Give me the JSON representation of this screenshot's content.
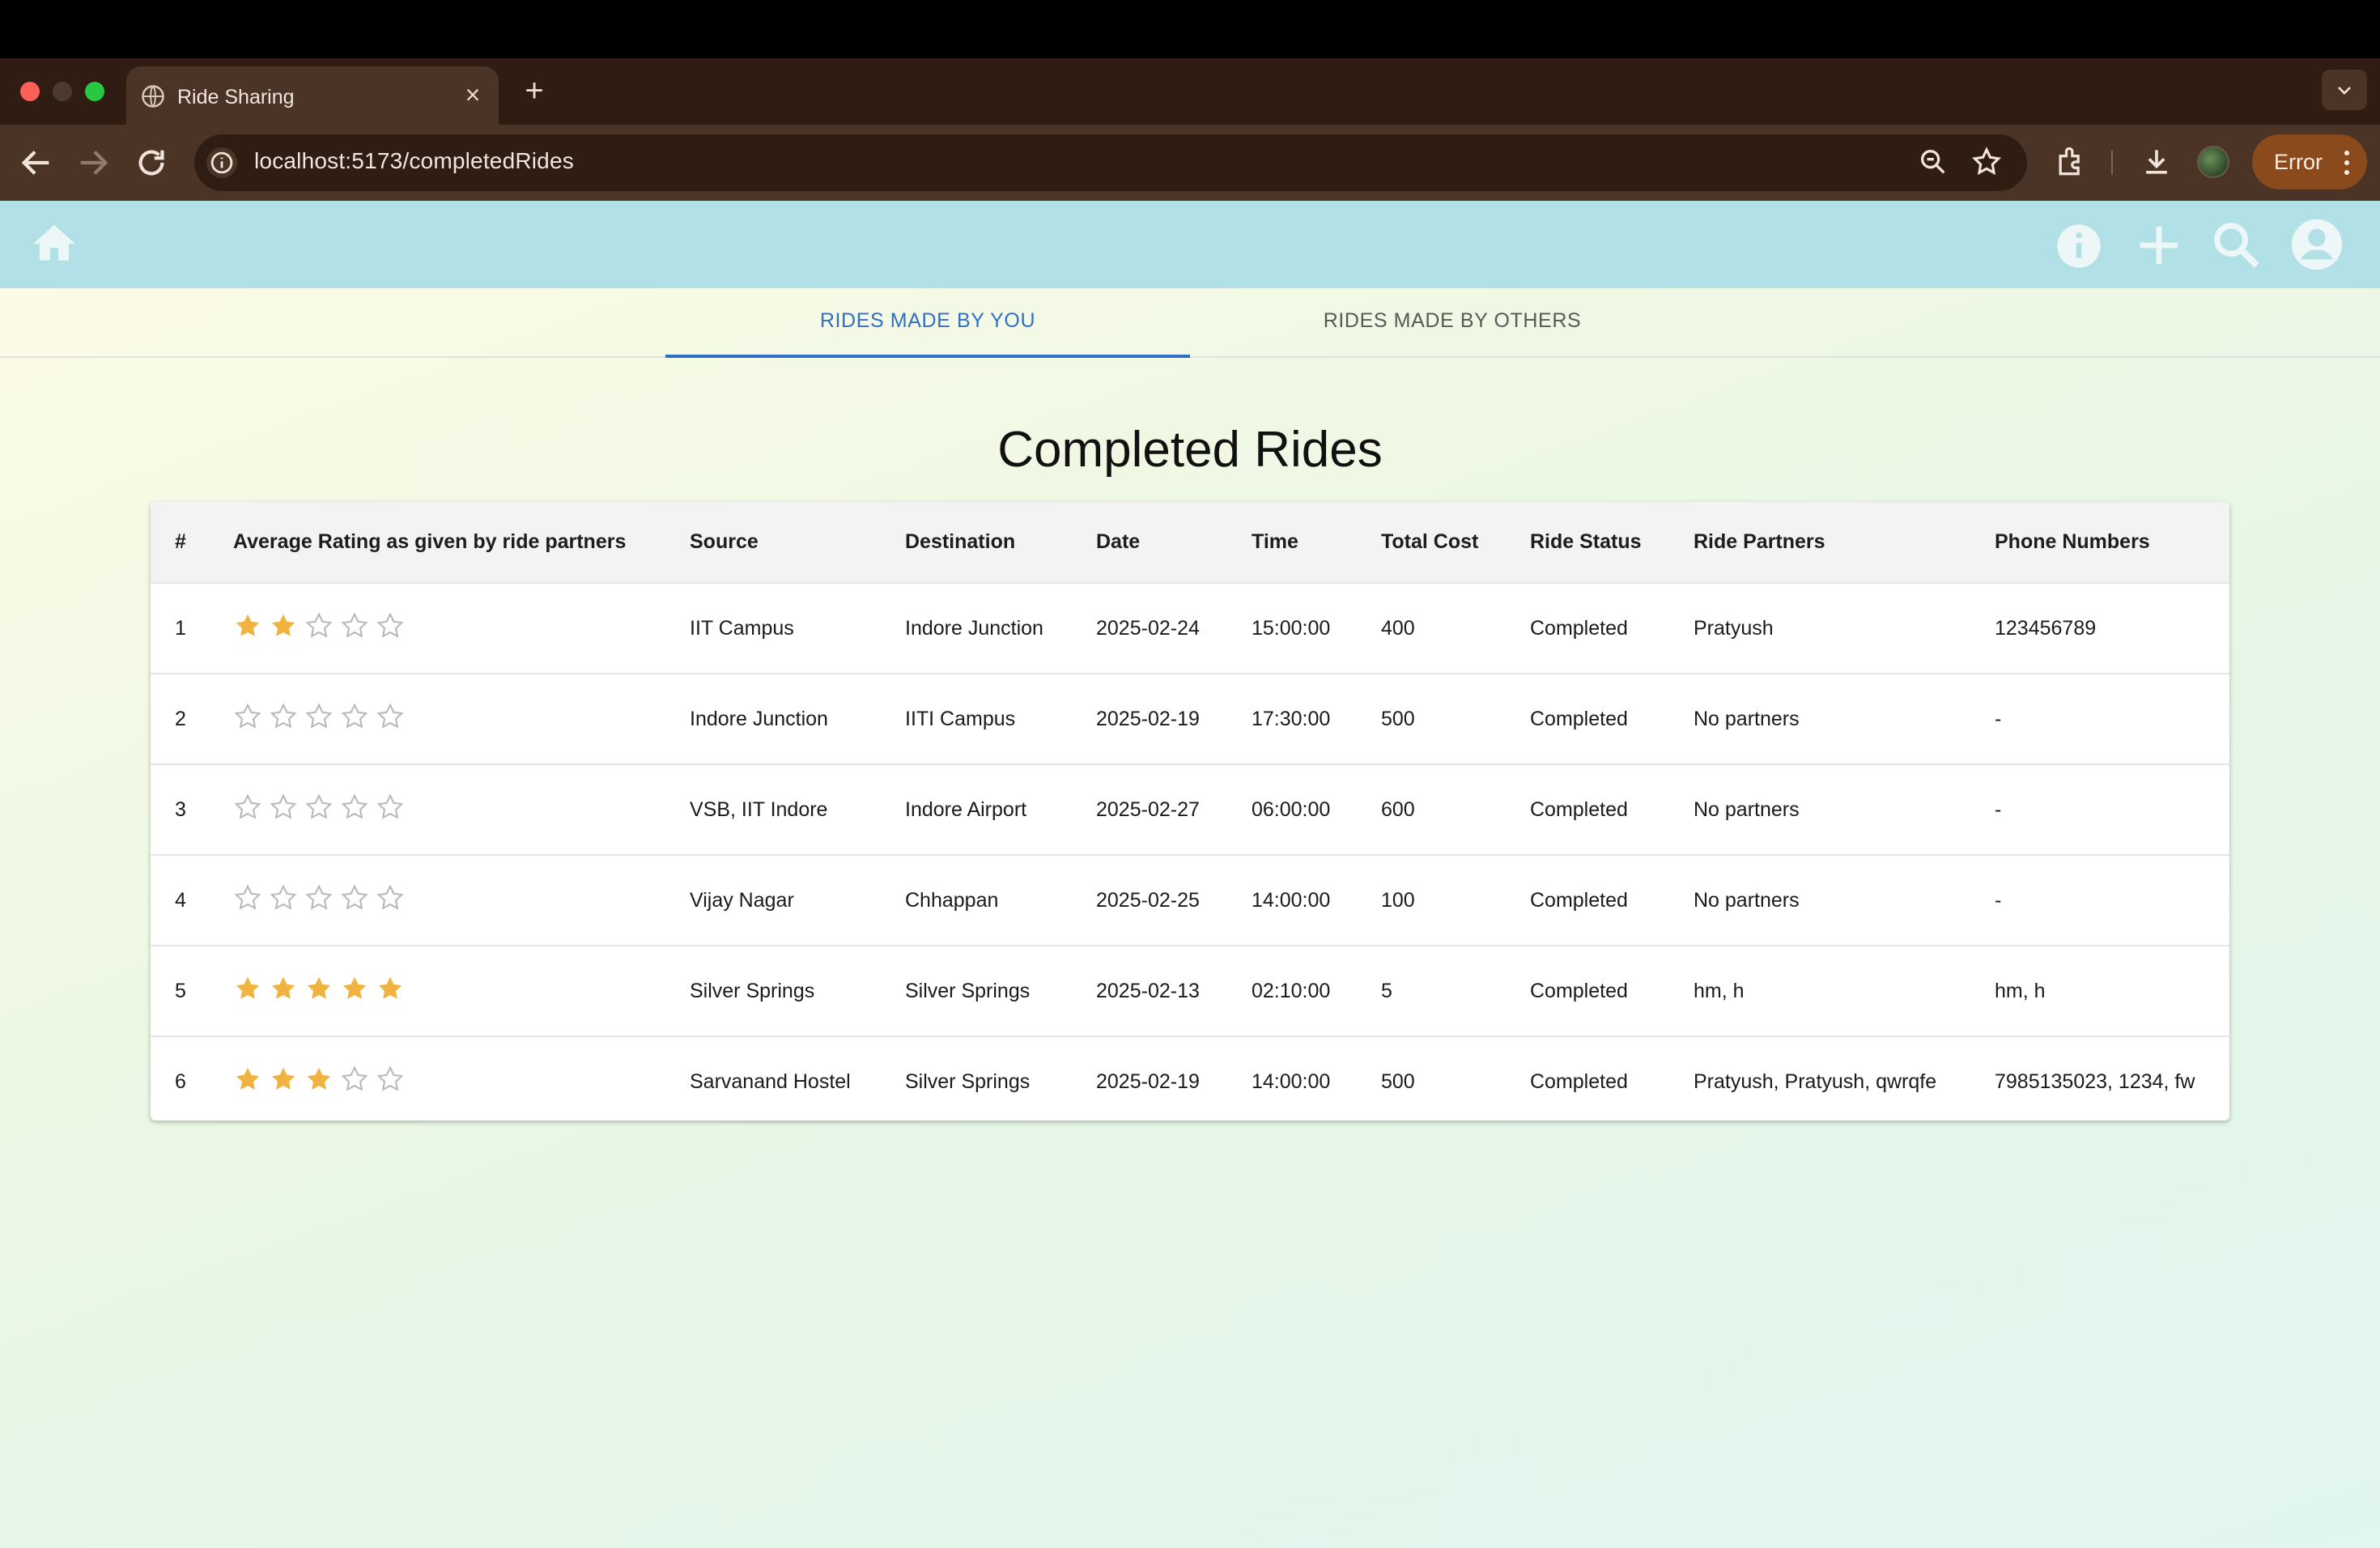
{
  "browser": {
    "tab_title": "Ride Sharing",
    "tab_close": "×",
    "new_tab": "+",
    "url": "localhost:5173/completedRides",
    "error_label": "Error"
  },
  "tabs": [
    {
      "label": "RIDES MADE BY YOU",
      "active": true
    },
    {
      "label": "RIDES MADE BY OTHERS",
      "active": false
    }
  ],
  "page_title": "Completed Rides",
  "table": {
    "headers": [
      "#",
      "Average Rating as given by ride partners",
      "Source",
      "Destination",
      "Date",
      "Time",
      "Total Cost",
      "Ride Status",
      "Ride Partners",
      "Phone Numbers"
    ],
    "rows": [
      {
        "num": "1",
        "rating": 2,
        "source": "IIT Campus",
        "destination": "Indore Junction",
        "date": "2025-02-24",
        "time": "15:00:00",
        "cost": "400",
        "status": "Completed",
        "partners": "Pratyush",
        "phones": "123456789"
      },
      {
        "num": "2",
        "rating": 0,
        "source": "Indore Junction",
        "destination": "IITI Campus",
        "date": "2025-02-19",
        "time": "17:30:00",
        "cost": "500",
        "status": "Completed",
        "partners": "No partners",
        "phones": "-"
      },
      {
        "num": "3",
        "rating": 0,
        "source": "VSB, IIT Indore",
        "destination": "Indore Airport",
        "date": "2025-02-27",
        "time": "06:00:00",
        "cost": "600",
        "status": "Completed",
        "partners": "No partners",
        "phones": "-"
      },
      {
        "num": "4",
        "rating": 0,
        "source": "Vijay Nagar",
        "destination": "Chhappan",
        "date": "2025-02-25",
        "time": "14:00:00",
        "cost": "100",
        "status": "Completed",
        "partners": "No partners",
        "phones": "-"
      },
      {
        "num": "5",
        "rating": 5,
        "source": "Silver Springs",
        "destination": "Silver Springs",
        "date": "2025-02-13",
        "time": "02:10:00",
        "cost": "5",
        "status": "Completed",
        "partners": "hm, h",
        "phones": "hm, h"
      },
      {
        "num": "6",
        "rating": 3,
        "source": "Sarvanand Hostel",
        "destination": "Silver Springs",
        "date": "2025-02-19",
        "time": "14:00:00",
        "cost": "500",
        "status": "Completed",
        "partners": "Pratyush, Pratyush, qwrqfe",
        "phones": "7985135023, 1234, fw"
      }
    ]
  },
  "colors": {
    "star_filled": "#f0b33f",
    "star_empty": "#b9b9b9",
    "tab_active": "#2f6fc6",
    "appbar": "#b1e0e6"
  },
  "icons": {
    "app_home": "home-icon",
    "app_info": "info-icon",
    "app_add": "add-icon",
    "app_search": "search-icon",
    "app_account": "account-icon"
  }
}
